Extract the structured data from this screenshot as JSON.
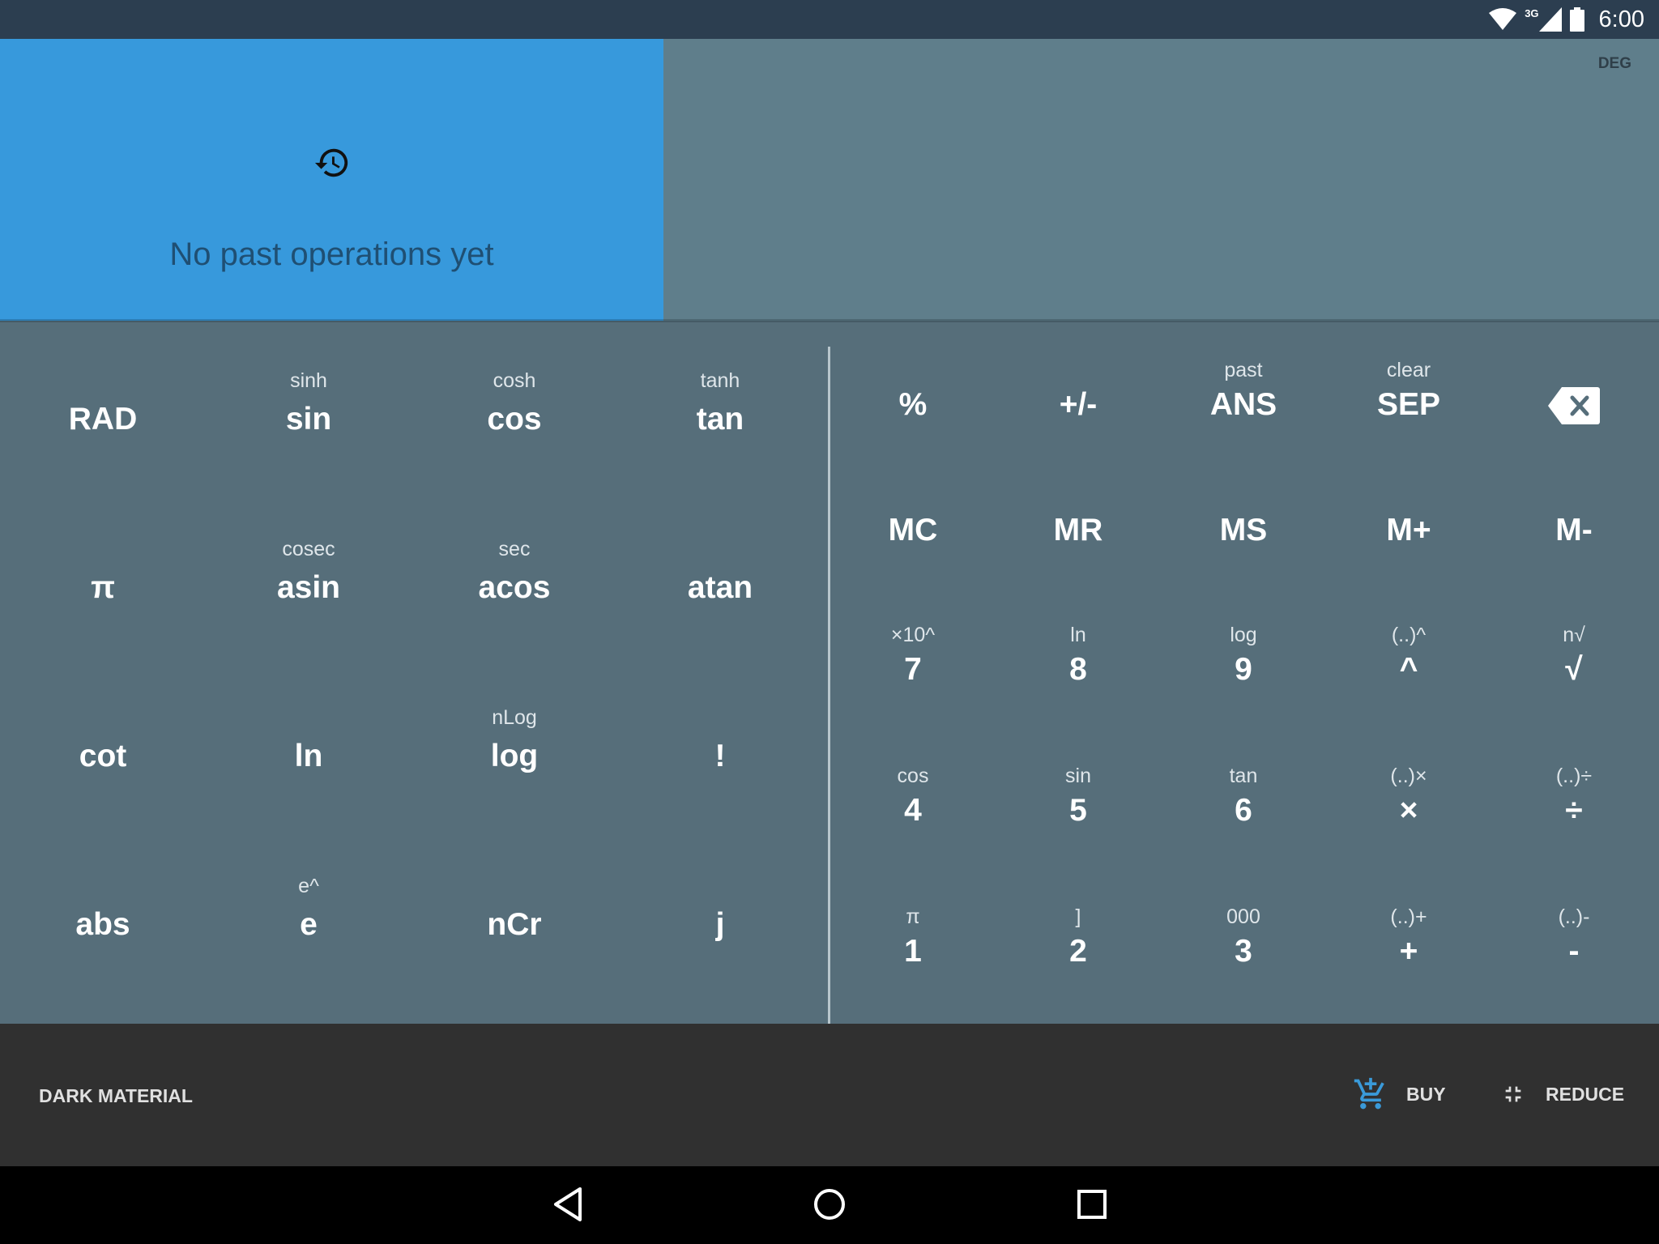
{
  "status": {
    "time": "6:00",
    "network": "3G"
  },
  "history": {
    "empty_text": "No past operations yet"
  },
  "display": {
    "angle_mode": "DEG"
  },
  "sci_keys": [
    {
      "main": "RAD",
      "sub": ""
    },
    {
      "main": "sin",
      "sub": "sinh"
    },
    {
      "main": "cos",
      "sub": "cosh"
    },
    {
      "main": "tan",
      "sub": "tanh"
    },
    {
      "main": "π",
      "sub": ""
    },
    {
      "main": "asin",
      "sub": "cosec"
    },
    {
      "main": "acos",
      "sub": "sec"
    },
    {
      "main": "atan",
      "sub": ""
    },
    {
      "main": "cot",
      "sub": ""
    },
    {
      "main": "ln",
      "sub": ""
    },
    {
      "main": "log",
      "sub": "nLog"
    },
    {
      "main": "!",
      "sub": ""
    },
    {
      "main": "abs",
      "sub": ""
    },
    {
      "main": "e",
      "sub": "e^"
    },
    {
      "main": "nCr",
      "sub": ""
    },
    {
      "main": "j",
      "sub": ""
    }
  ],
  "std_keys": [
    {
      "main": "%",
      "sub": ""
    },
    {
      "main": "+/-",
      "sub": ""
    },
    {
      "main": "ANS",
      "sub": "past"
    },
    {
      "main": "SEP",
      "sub": "clear"
    },
    {
      "main": "",
      "sub": "",
      "icon": "backspace-icon"
    },
    {
      "main": "MC",
      "sub": ""
    },
    {
      "main": "MR",
      "sub": ""
    },
    {
      "main": "MS",
      "sub": ""
    },
    {
      "main": "M+",
      "sub": ""
    },
    {
      "main": "M-",
      "sub": ""
    },
    {
      "main": "7",
      "sub": "×10^"
    },
    {
      "main": "8",
      "sub": "ln"
    },
    {
      "main": "9",
      "sub": "log"
    },
    {
      "main": "^",
      "sub": "(..)^"
    },
    {
      "main": "√",
      "sub": "n√"
    },
    {
      "main": "4",
      "sub": "cos"
    },
    {
      "main": "5",
      "sub": "sin"
    },
    {
      "main": "6",
      "sub": "tan"
    },
    {
      "main": "×",
      "sub": "(..)×"
    },
    {
      "main": "÷",
      "sub": "(..)÷"
    },
    {
      "main": "1",
      "sub": "π"
    },
    {
      "main": "2",
      "sub": "]"
    },
    {
      "main": "3",
      "sub": "000"
    },
    {
      "main": "+",
      "sub": "(..)+"
    },
    {
      "main": "-",
      "sub": "(..)-"
    }
  ],
  "bottom": {
    "theme": "DARK MATERIAL",
    "buy": "BUY",
    "reduce": "REDUCE"
  },
  "icons": [
    "wifi-icon",
    "cell-signal-icon",
    "battery-icon",
    "history-icon",
    "backspace-icon",
    "cart-icon",
    "reduce-icon",
    "back-icon",
    "home-icon",
    "recents-icon"
  ],
  "colors": {
    "history_bg": "#3799dc",
    "display_bg": "#5f7e8b",
    "keypad_bg": "#566e7a",
    "buy_icon": "#3a9ad9"
  }
}
